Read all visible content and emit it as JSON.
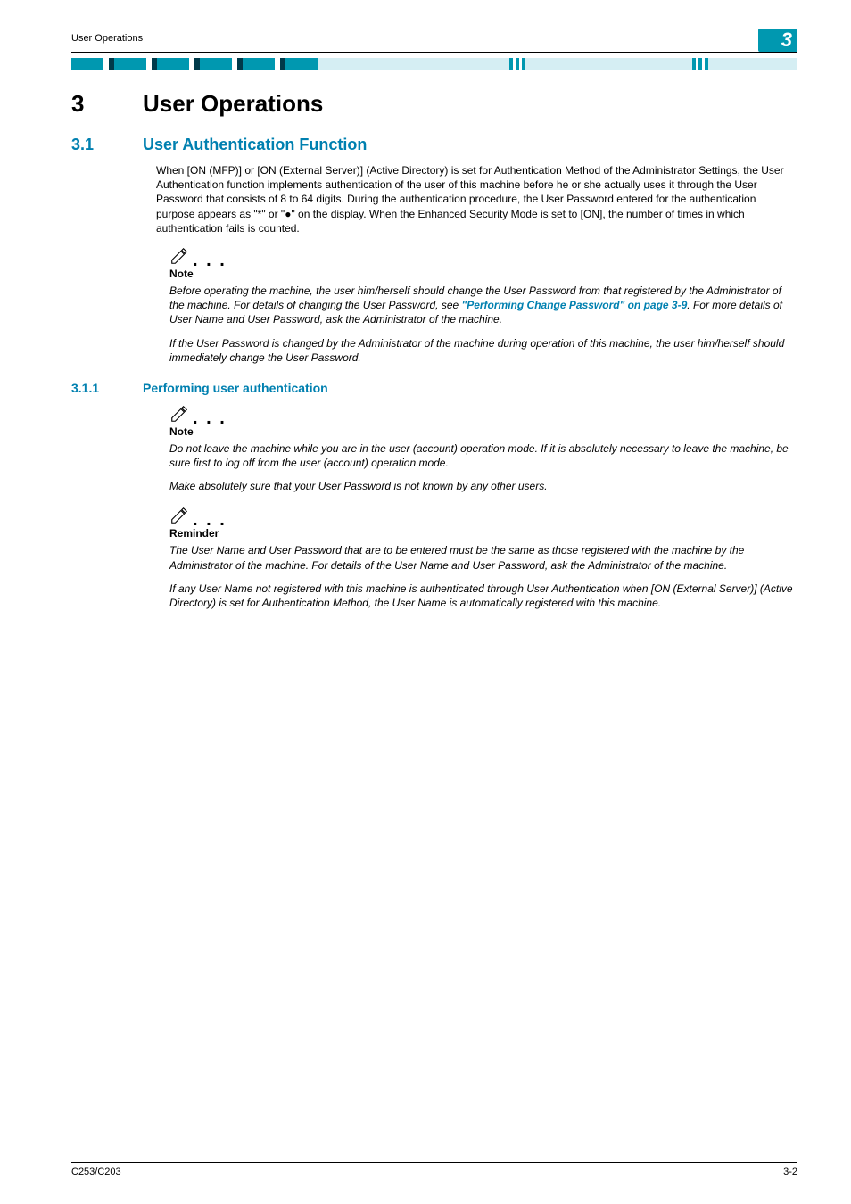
{
  "header": {
    "running_head": "User Operations",
    "badge": "3"
  },
  "chapter": {
    "number": "3",
    "title": "User Operations"
  },
  "section": {
    "number": "3.1",
    "title": "User Authentication Function",
    "intro": "When [ON (MFP)] or [ON (External Server)] (Active Directory) is set for Authentication Method of the Administrator Settings, the User Authentication function implements authentication of the user of this machine before he or she actually uses it through the User Password that consists of 8 to 64 digits. During the authentication procedure, the User Password entered for the authentication purpose appears as \"*\" or \"●\" on the display. When the Enhanced Security Mode is set to [ON], the number of times in which authentication fails is counted."
  },
  "note1": {
    "title": "Note",
    "p1a": "Before operating the machine, the user him/herself should change the User Password from that registered by the Administrator of the machine. For details of changing the User Password, see ",
    "link": "\"Performing Change Password\" on page 3-9",
    "p1b": ". For more details of User Name and User Password, ask the Administrator of the machine.",
    "p2": "If the User Password is changed by the Administrator of the machine during operation of this machine, the user him/herself should immediately change the User Password."
  },
  "subsection": {
    "number": "3.1.1",
    "title": "Performing user authentication"
  },
  "note2": {
    "title": "Note",
    "p1": "Do not leave the machine while you are in the user (account) operation mode. If it is absolutely necessary to leave the machine, be sure first to log off from the user (account) operation mode.",
    "p2": "Make absolutely sure that your User Password is not known by any other users."
  },
  "reminder": {
    "title": "Reminder",
    "p1": "The User Name and User Password that are to be entered must be the same as those registered with the machine by the Administrator of the machine. For details of the User Name and User Password, ask the Administrator of the machine.",
    "p2": "If any User Name not registered with this machine is authenticated through User Authentication when [ON (External Server)] (Active Directory) is set for Authentication Method, the User Name is automatically registered with this machine."
  },
  "footer": {
    "left": "C253/C203",
    "right": "3-2"
  }
}
